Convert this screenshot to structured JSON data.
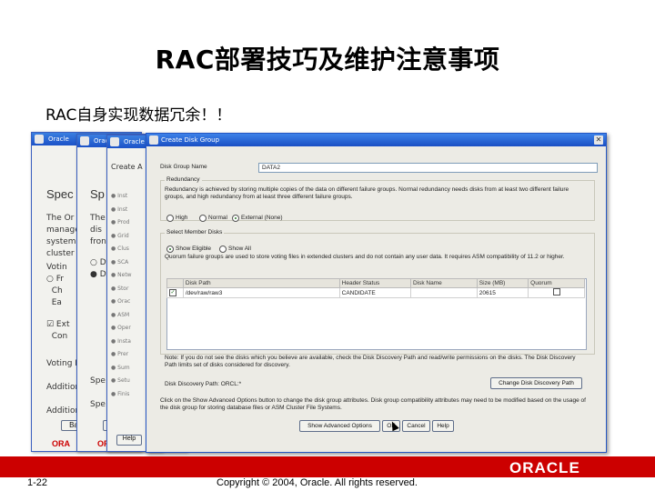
{
  "slide": {
    "title": "RAC部署技巧及维护注意事项",
    "subtitle": "RAC自身实现数据冗余！！",
    "page_number": "1-22",
    "copyright": "Copyright © 2004, Oracle.  All rights reserved.",
    "logo_text": "ORACLE",
    "accent_color": "#cc0000"
  },
  "background_windows": [
    {
      "title": "Oracle",
      "heading": "Spec",
      "logo": "ORA"
    },
    {
      "title": "Oracle",
      "heading": "Sp",
      "logo": "ORA"
    },
    {
      "title": "Oracle",
      "heading": "Create A",
      "logo": "Help"
    }
  ],
  "dialog": {
    "title": "Create Disk Group",
    "disk_group_name_label": "Disk Group Name",
    "disk_group_name_value": "DATA2",
    "redundancy_group_label": "Redundancy",
    "redundancy_desc": "Redundancy is achieved by storing multiple copies of the data on different failure groups. Normal redundancy needs disks from at least two different failure groups, and high redundancy from at least three different failure groups.",
    "redundancy_options": [
      "High",
      "Normal",
      "External (None)"
    ],
    "redundancy_selected": "External (None)",
    "member_disks_label": "Select Member Disks",
    "member_disks_options": [
      "Show Eligible",
      "Show All"
    ],
    "member_disks_selected": "Show Eligible",
    "quorum_desc": "Quorum failure groups are used to store voting files in extended clusters and do not contain any user data. It requires ASM compatibility of 11.2 or higher.",
    "table_headers": [
      "Disk Path",
      "Header Status",
      "Disk Name",
      "Size (MB)",
      "Quorum"
    ],
    "table_rows": [
      {
        "path": "/dev/raw/raw3",
        "status": "CANDIDATE",
        "name": "",
        "size": "20615",
        "checked": true
      }
    ],
    "note": "Note: If you do not see the disks which you believe are available, check the Disk Discovery Path and read/write permissions on the disks. The Disk Discovery Path limits set of disks considered for discovery.",
    "discovery_path_label": "Disk Discovery Path: ORCL:*",
    "change_discovery_button": "Change Disk Discovery Path",
    "advanced_note": "Click on the Show Advanced Options button to change the disk group attributes. Disk group compatibility attributes may need to be modified based on the usage of the disk group for storing database files or ASM Cluster File Systems.",
    "buttons": {
      "advanced": "Show Advanced Options",
      "ok": "OK",
      "cancel": "Cancel",
      "help": "Help"
    }
  }
}
